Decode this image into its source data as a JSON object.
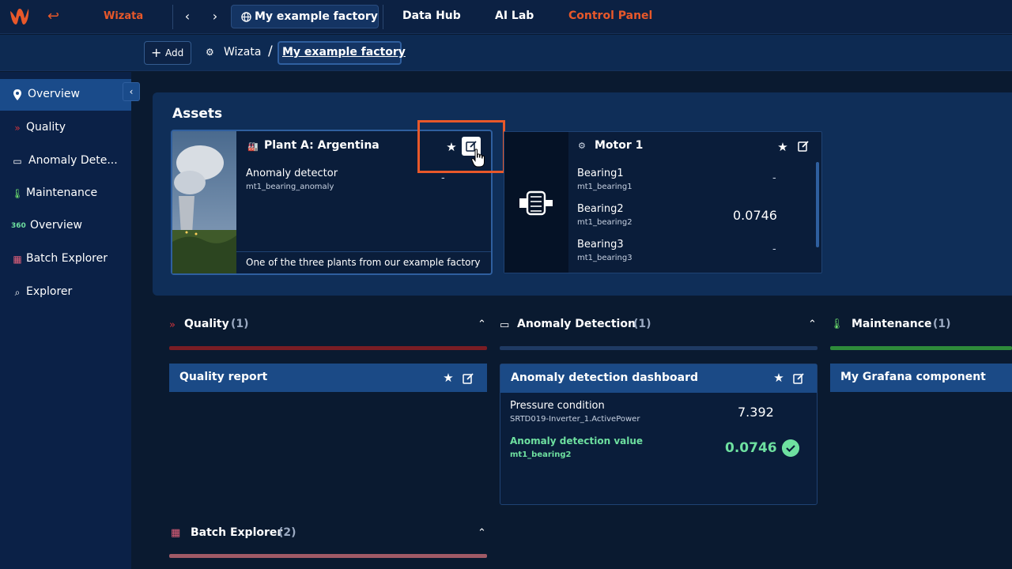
{
  "topbar": {
    "brand": "Wizata",
    "factory_tab": "My example factory",
    "nav": [
      "Data Hub",
      "AI Lab",
      "Control Panel"
    ],
    "active_nav": "Control Panel",
    "accent_color": "#e8582a"
  },
  "subbar": {
    "add_label": "Add",
    "breadcrumb_root": "Wizata",
    "breadcrumb_sep": "/",
    "breadcrumb_current": "My example factory"
  },
  "sidebar": {
    "items": [
      {
        "label": "Overview",
        "icon": "map-pin-icon",
        "active": true
      },
      {
        "label": "Quality",
        "icon": "chevrons-down-icon"
      },
      {
        "label": "Anomaly Dete...",
        "icon": "monitor-icon"
      },
      {
        "label": "Maintenance",
        "icon": "thermometer-icon"
      },
      {
        "label": "Overview",
        "icon": "360-icon"
      },
      {
        "label": "Batch Explorer",
        "icon": "batch-icon"
      },
      {
        "label": "Explorer",
        "icon": "search-graph-icon"
      }
    ]
  },
  "assets": {
    "title": "Assets",
    "cards": [
      {
        "title": "Plant A: Argentina",
        "icon": "factory-icon",
        "signals": [
          {
            "name": "Anomaly detector",
            "id": "mt1_bearing_anomaly",
            "value": "-"
          }
        ],
        "footer": "One of the three plants from our example factory"
      },
      {
        "title": "Motor 1",
        "icon": "motor-icon",
        "signals": [
          {
            "name": "Bearing1",
            "id": "mt1_bearing1",
            "value": "-"
          },
          {
            "name": "Bearing2",
            "id": "mt1_bearing2",
            "value": "0.0746"
          },
          {
            "name": "Bearing3",
            "id": "mt1_bearing3",
            "value": "-"
          }
        ]
      }
    ]
  },
  "sections": [
    {
      "title": "Quality",
      "count": "(1)",
      "color": "#7a1d24"
    },
    {
      "title": "Anomaly Detection",
      "count": "(1)",
      "color": "#1f3a63"
    },
    {
      "title": "Maintenance",
      "count": "(1)",
      "color": "#2e8b3a"
    },
    {
      "title": "Batch Explorer",
      "count": "(2)",
      "color": "#a05a66"
    }
  ],
  "dashboards": {
    "quality": {
      "title": "Quality report"
    },
    "anomaly": {
      "title": "Anomaly detection dashboard",
      "rows": [
        {
          "name": "Pressure condition",
          "id": "SRTD019-Inverter_1.ActivePower",
          "value": "7.392"
        },
        {
          "name": "Anomaly detection value",
          "id": "mt1_bearing2",
          "value": "0.0746",
          "highlight_color": "#6ee0a0"
        }
      ]
    },
    "maintenance": {
      "title": "My Grafana component"
    }
  }
}
